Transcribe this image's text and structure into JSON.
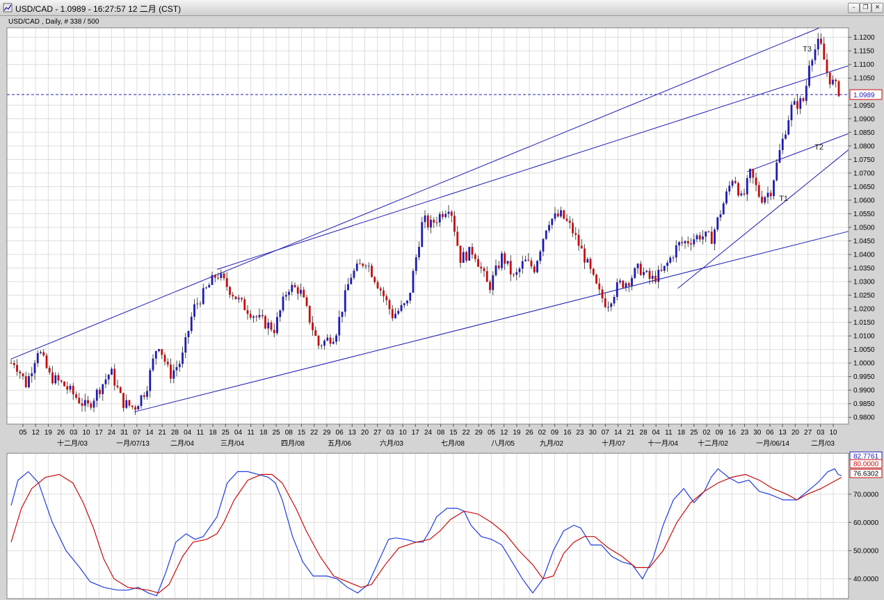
{
  "window": {
    "title": "USD/CAD - 1.0989 - 16:27:57  12 二月 (CST)",
    "buttons": [
      "minimize",
      "restore",
      "close"
    ]
  },
  "colors": {
    "bull_candle": "#1c1cb4",
    "bear_candle": "#c80a0a",
    "trendline": "#1c1cb4",
    "stoch_k": "#1e3cdc",
    "stoch_d": "#c80a0a",
    "grid": "#dcdcdc"
  },
  "price_panel": {
    "caption": "USD/CAD , Daily, # 338 / 500",
    "current_price_label": "1.0989",
    "y_ticks": [
      "1.1200",
      "1.1150",
      "1.1100",
      "1.1050",
      "1.0950",
      "1.0900",
      "1.0850",
      "1.0800",
      "1.0750",
      "1.0700",
      "1.0650",
      "1.0600",
      "1.0550",
      "1.0500",
      "1.0450",
      "1.0400",
      "1.0350",
      "1.0300",
      "1.0250",
      "1.0200",
      "1.0150",
      "1.0100",
      "1.0050",
      "1.0000",
      "0.9950",
      "0.9900",
      "0.9850",
      "0.9800"
    ],
    "x_day_labels": [
      "05",
      "12",
      "19",
      "26",
      "03",
      "10",
      "17",
      "24",
      "31",
      "07",
      "14",
      "21",
      "28",
      "04",
      "11",
      "18",
      "25",
      "04",
      "11",
      "18",
      "25",
      "08",
      "15",
      "22",
      "29",
      "06",
      "13",
      "20",
      "27",
      "03",
      "10",
      "17",
      "24",
      "08",
      "15",
      "22",
      "29",
      "05",
      "12",
      "19",
      "26",
      "02",
      "09",
      "16",
      "23",
      "30",
      "07",
      "14",
      "21",
      "28",
      "04",
      "11",
      "18",
      "25",
      "02",
      "09",
      "16",
      "23",
      "30",
      "06",
      "13",
      "20",
      "27",
      "03",
      "10"
    ],
    "x_month_labels": [
      "十二月/03",
      "一月/07/13",
      "二月/04",
      "三月/04",
      "四月/08",
      "五月/06",
      "六月/03",
      "七月/08",
      "八月/05",
      "九月/02",
      "十月/07",
      "十一月/04",
      "十二月/02",
      "一月/06/14",
      "二月/03"
    ],
    "annotations": [
      "T3",
      "T2",
      "T1"
    ]
  },
  "indicator_panel": {
    "y_ticks": [
      "70.0000",
      "60.0000",
      "50.0000",
      "40.0000"
    ],
    "value_labels": [
      "82.7761",
      "80.0000",
      "76.6302"
    ]
  },
  "chart_data": [
    {
      "type": "candlestick",
      "title": "USD/CAD , Daily, # 338 / 500",
      "ylim": [
        0.9775,
        1.1235
      ],
      "current_price": 1.0989,
      "pivots": [
        {
          "date": "2012-12-03",
          "price": 1.0
        },
        {
          "date": "2012-12-05",
          "price": 1.0005
        },
        {
          "date": "2012-12-12",
          "price": 0.992
        },
        {
          "date": "2012-12-19",
          "price": 1.0055
        },
        {
          "date": "2012-12-26",
          "price": 0.995
        },
        {
          "date": "2013-01-03",
          "price": 0.992
        },
        {
          "date": "2013-01-17",
          "price": 0.9835
        },
        {
          "date": "2013-01-31",
          "price": 0.997
        },
        {
          "date": "2013-02-07",
          "price": 0.9855
        },
        {
          "date": "2013-02-14",
          "price": 0.9835
        },
        {
          "date": "2013-02-21",
          "price": 0.9905
        },
        {
          "date": "2013-02-28",
          "price": 1.008
        },
        {
          "date": "2013-03-07",
          "price": 0.9955
        },
        {
          "date": "2013-03-14",
          "price": 1.001
        },
        {
          "date": "2013-03-21",
          "price": 1.02
        },
        {
          "date": "2013-04-04",
          "price": 1.033
        },
        {
          "date": "2013-04-18",
          "price": 1.022
        },
        {
          "date": "2013-04-29",
          "price": 1.016
        },
        {
          "date": "2013-05-08",
          "price": 1.0125
        },
        {
          "date": "2013-05-16",
          "price": 1.028
        },
        {
          "date": "2013-05-23",
          "price": 1.027
        },
        {
          "date": "2013-06-03",
          "price": 1.0065
        },
        {
          "date": "2013-06-13",
          "price": 1.0105
        },
        {
          "date": "2013-06-22",
          "price": 1.032
        },
        {
          "date": "2013-07-01",
          "price": 1.038
        },
        {
          "date": "2013-07-10",
          "price": 1.027
        },
        {
          "date": "2013-07-17",
          "price": 1.0175
        },
        {
          "date": "2013-07-26",
          "price": 1.022
        },
        {
          "date": "2013-08-04",
          "price": 1.053
        },
        {
          "date": "2013-08-08",
          "price": 1.0505
        },
        {
          "date": "2013-08-20",
          "price": 1.0585
        },
        {
          "date": "2013-08-26",
          "price": 1.0385
        },
        {
          "date": "2013-09-03",
          "price": 1.0415
        },
        {
          "date": "2013-09-12",
          "price": 1.0275
        },
        {
          "date": "2013-09-20",
          "price": 1.0395
        },
        {
          "date": "2013-09-27",
          "price": 1.031
        },
        {
          "date": "2013-10-03",
          "price": 1.0375
        },
        {
          "date": "2013-10-09",
          "price": 1.035
        },
        {
          "date": "2013-10-17",
          "price": 1.0525
        },
        {
          "date": "2013-10-25",
          "price": 1.0545
        },
        {
          "date": "2013-10-31",
          "price": 1.0495
        },
        {
          "date": "2013-11-08",
          "price": 1.0385
        },
        {
          "date": "2013-11-16",
          "price": 1.026
        },
        {
          "date": "2013-11-21",
          "price": 1.0215
        },
        {
          "date": "2013-11-28",
          "price": 1.029
        },
        {
          "date": "2013-12-03",
          "price": 1.03
        },
        {
          "date": "2013-12-10",
          "price": 1.035
        },
        {
          "date": "2013-12-17",
          "price": 1.0305
        },
        {
          "date": "2013-12-24",
          "price": 1.0335
        },
        {
          "date": "2014-01-02",
          "price": 1.0435
        },
        {
          "date": "2014-01-08",
          "price": 1.045
        },
        {
          "date": "2014-01-15",
          "price": 1.047
        },
        {
          "date": "2014-01-22",
          "price": 1.046
        },
        {
          "date": "2014-01-28",
          "price": 1.057
        },
        {
          "date": "2014-02-04",
          "price": 1.0695
        },
        {
          "date": "2014-02-09",
          "price": 1.0595
        },
        {
          "date": "2014-02-14",
          "price": 1.07
        },
        {
          "date": "2014-02-20",
          "price": 1.0605
        },
        {
          "date": "2014-02-26",
          "price": 1.0635
        },
        {
          "date": "2014-03-03",
          "price": 1.077
        },
        {
          "date": "2014-03-10",
          "price": 1.094
        },
        {
          "date": "2014-03-18",
          "price": 1.097
        },
        {
          "date": "2014-03-21",
          "price": 1.112
        },
        {
          "date": "2014-03-27",
          "price": 1.1185
        },
        {
          "date": "2014-04-01",
          "price": 1.1055
        },
        {
          "date": "2014-04-09",
          "price": 1.0989
        }
      ],
      "trendlines": [
        {
          "label": "",
          "from": {
            "date": "2012-12-03",
            "price": 1.0015
          },
          "to": {
            "date": "2014-03-27",
            "price": 1.1235
          }
        },
        {
          "label": "",
          "from": {
            "date": "2013-04-04",
            "price": 1.0345
          },
          "to": {
            "date": "2014-04-13",
            "price": 1.1095
          }
        },
        {
          "label": "",
          "from": {
            "date": "2013-02-14",
            "price": 0.982
          },
          "to": {
            "date": "2014-04-13",
            "price": 1.0485
          }
        },
        {
          "label": "",
          "from": {
            "date": "2014-01-02",
            "price": 1.0275
          },
          "to": {
            "date": "2014-04-13",
            "price": 1.0785
          }
        },
        {
          "label": "",
          "from": {
            "date": "2014-02-12",
            "price": 1.0705
          },
          "to": {
            "date": "2014-04-13",
            "price": 1.0845
          }
        },
        {
          "label": "T1",
          "from": {
            "date": "2014-03-03",
            "price": 1.0605
          },
          "to": {
            "date": "2014-03-03",
            "price": 1.0605
          }
        },
        {
          "label": "T2",
          "from": {
            "date": "2014-03-24",
            "price": 1.0795
          },
          "to": {
            "date": "2014-03-24",
            "price": 1.0795
          }
        },
        {
          "label": "T3",
          "from": {
            "date": "2014-03-17",
            "price": 1.1155
          },
          "to": {
            "date": "2014-03-17",
            "price": 1.1155
          }
        }
      ]
    },
    {
      "type": "line",
      "ylim": [
        33,
        84.5
      ],
      "ticks": [
        70,
        60,
        50,
        40
      ],
      "series": [
        {
          "name": "",
          "color": "#1e3cdc",
          "values": [
            [
              0,
              66
            ],
            [
              10,
              75
            ],
            [
              25,
              78
            ],
            [
              40,
              74
            ],
            [
              60,
              60
            ],
            [
              80,
              50
            ],
            [
              100,
              44
            ],
            [
              115,
              39
            ],
            [
              135,
              37
            ],
            [
              155,
              36
            ],
            [
              170,
              36
            ],
            [
              185,
              37
            ],
            [
              200,
              35
            ],
            [
              212,
              34
            ],
            [
              225,
              42
            ],
            [
              240,
              53
            ],
            [
              255,
              56
            ],
            [
              268,
              54
            ],
            [
              280,
              55
            ],
            [
              300,
              62
            ],
            [
              315,
              74
            ],
            [
              330,
              78
            ],
            [
              345,
              78
            ],
            [
              360,
              77
            ],
            [
              375,
              76
            ],
            [
              385,
              74
            ],
            [
              395,
              68
            ],
            [
              410,
              55
            ],
            [
              425,
              46
            ],
            [
              440,
              41
            ],
            [
              460,
              41
            ],
            [
              475,
              40
            ],
            [
              490,
              37
            ],
            [
              505,
              35
            ],
            [
              520,
              38
            ],
            [
              535,
              46
            ],
            [
              550,
              54
            ],
            [
              560,
              54.5
            ],
            [
              575,
              54
            ],
            [
              590,
              53
            ],
            [
              600,
              53
            ],
            [
              610,
              57
            ],
            [
              620,
              62
            ],
            [
              635,
              65
            ],
            [
              650,
              65
            ],
            [
              660,
              64
            ],
            [
              670,
              59
            ],
            [
              685,
              55
            ],
            [
              700,
              54
            ],
            [
              715,
              52
            ],
            [
              730,
              46
            ],
            [
              745,
              40
            ],
            [
              760,
              35
            ],
            [
              775,
              40
            ],
            [
              790,
              50
            ],
            [
              805,
              57
            ],
            [
              820,
              59
            ],
            [
              830,
              58
            ],
            [
              845,
              52
            ],
            [
              860,
              52
            ],
            [
              875,
              48
            ],
            [
              890,
              46
            ],
            [
              905,
              45
            ],
            [
              920,
              40
            ],
            [
              935,
              47
            ],
            [
              950,
              59
            ],
            [
              965,
              68
            ],
            [
              980,
              72
            ],
            [
              995,
              67
            ],
            [
              1010,
              71
            ],
            [
              1020,
              76
            ],
            [
              1030,
              79
            ],
            [
              1045,
              76
            ],
            [
              1060,
              74
            ],
            [
              1075,
              75
            ],
            [
              1090,
              71
            ],
            [
              1105,
              70
            ],
            [
              1125,
              68
            ],
            [
              1145,
              68
            ],
            [
              1160,
              71
            ],
            [
              1175,
              74
            ],
            [
              1190,
              78
            ],
            [
              1200,
              79
            ],
            [
              1205,
              77
            ],
            [
              1210,
              76.6
            ]
          ]
        },
        {
          "name": "",
          "color": "#c80a0a",
          "values": [
            [
              0,
              53
            ],
            [
              15,
              65
            ],
            [
              30,
              72
            ],
            [
              50,
              76
            ],
            [
              70,
              77
            ],
            [
              90,
              74
            ],
            [
              105,
              67
            ],
            [
              120,
              58
            ],
            [
              135,
              47
            ],
            [
              150,
              40
            ],
            [
              170,
              37
            ],
            [
              185,
              36.5
            ],
            [
              200,
              36
            ],
            [
              215,
              35
            ],
            [
              230,
              38
            ],
            [
              250,
              48
            ],
            [
              265,
              53
            ],
            [
              285,
              54
            ],
            [
              300,
              56
            ],
            [
              310,
              60
            ],
            [
              325,
              68
            ],
            [
              345,
              75
            ],
            [
              365,
              77
            ],
            [
              380,
              77
            ],
            [
              395,
              74
            ],
            [
              415,
              65
            ],
            [
              430,
              57
            ],
            [
              450,
              48
            ],
            [
              470,
              41
            ],
            [
              490,
              39
            ],
            [
              510,
              37
            ],
            [
              525,
              38
            ],
            [
              545,
              45
            ],
            [
              565,
              51
            ],
            [
              590,
              53
            ],
            [
              610,
              54
            ],
            [
              625,
              57
            ],
            [
              640,
              61
            ],
            [
              660,
              64
            ],
            [
              680,
              63
            ],
            [
              700,
              60
            ],
            [
              720,
              56
            ],
            [
              740,
              50
            ],
            [
              760,
              45
            ],
            [
              775,
              40
            ],
            [
              790,
              41
            ],
            [
              805,
              49
            ],
            [
              820,
              53
            ],
            [
              835,
              55
            ],
            [
              850,
              55
            ],
            [
              870,
              51
            ],
            [
              890,
              48
            ],
            [
              910,
              44
            ],
            [
              930,
              44
            ],
            [
              950,
              50
            ],
            [
              970,
              60
            ],
            [
              990,
              67
            ],
            [
              1010,
              71
            ],
            [
              1030,
              74
            ],
            [
              1050,
              76
            ],
            [
              1070,
              77
            ],
            [
              1090,
              75
            ],
            [
              1110,
              72
            ],
            [
              1130,
              70
            ],
            [
              1145,
              68
            ],
            [
              1160,
              70
            ],
            [
              1180,
              72
            ],
            [
              1195,
              74
            ],
            [
              1210,
              76
            ]
          ]
        }
      ]
    }
  ]
}
